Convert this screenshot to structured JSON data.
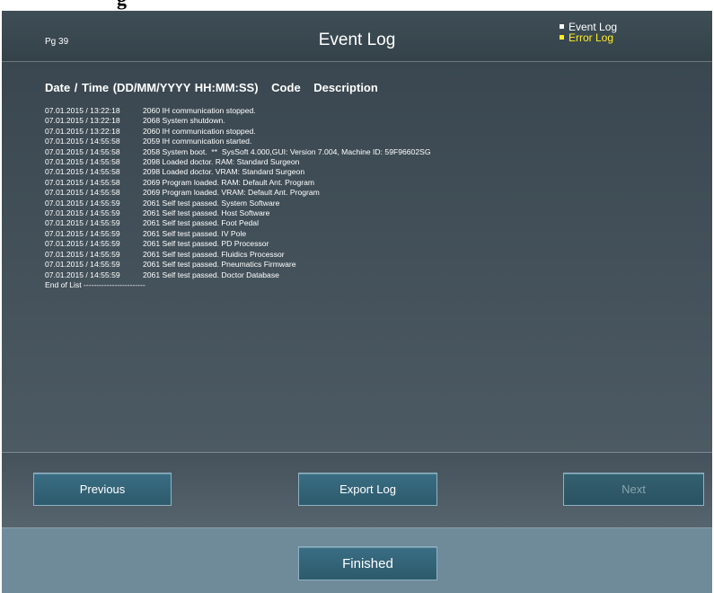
{
  "caption_fragment": "g",
  "header": {
    "page_number": "Pg 39",
    "title": "Event Log",
    "legend": {
      "event_log": "Event Log",
      "error_log": "Error Log"
    }
  },
  "colors": {
    "error_log_accent": "#ffee22",
    "button_fill": "#34667b",
    "footer_fill": "#6f8b99"
  },
  "log": {
    "columns": [
      "Date / Time (DD/MM/YYYY HH:MM:SS)",
      "Code",
      "Description"
    ],
    "rows": [
      {
        "datetime": "07.01.2015 / 13:22:18",
        "entry": "2060 IH communication stopped."
      },
      {
        "datetime": "07.01.2015 / 13:22:18",
        "entry": "2068 System shutdown."
      },
      {
        "datetime": "07.01.2015 / 13:22:18",
        "entry": "2060 IH communication stopped."
      },
      {
        "datetime": "07.01.2015 / 14:55:58",
        "entry": "2059 IH communication started."
      },
      {
        "datetime": "07.01.2015 / 14:55:58",
        "entry": "2058 System boot.  **  SysSoft 4.000,GUI: Version 7.004, Machine ID: 59F96602SG"
      },
      {
        "datetime": "07.01.2015 / 14:55:58",
        "entry": "2098 Loaded doctor. RAM: Standard Surgeon"
      },
      {
        "datetime": "07.01.2015 / 14:55:58",
        "entry": "2098 Loaded doctor. VRAM: Standard Surgeon"
      },
      {
        "datetime": "07.01.2015 / 14:55:58",
        "entry": "2069 Program loaded. RAM: Default Ant. Program"
      },
      {
        "datetime": "07.01.2015 / 14:55:58",
        "entry": "2069 Program loaded. VRAM: Default Ant. Program"
      },
      {
        "datetime": "07.01.2015 / 14:55:59",
        "entry": "2061 Self test passed. System Software"
      },
      {
        "datetime": "07.01.2015 / 14:55:59",
        "entry": "2061 Self test passed. Host Software"
      },
      {
        "datetime": "07.01.2015 / 14:55:59",
        "entry": "2061 Self test passed. Foot Pedal"
      },
      {
        "datetime": "07.01.2015 / 14:55:59",
        "entry": "2061 Self test passed. IV Pole"
      },
      {
        "datetime": "07.01.2015 / 14:55:59",
        "entry": "2061 Self test passed. PD Processor"
      },
      {
        "datetime": "07.01.2015 / 14:55:59",
        "entry": "2061 Self test passed. Fluidics Processor"
      },
      {
        "datetime": "07.01.2015 / 14:55:59",
        "entry": "2061 Self test passed. Pneumatics Firmware"
      },
      {
        "datetime": "07.01.2015 / 14:55:59",
        "entry": "2061 Self test passed. Doctor Database"
      }
    ],
    "end_marker": "End of List ------------------------"
  },
  "nav": {
    "previous": "Previous",
    "export_log": "Export Log",
    "next": "Next"
  },
  "footer": {
    "finished": "Finished"
  }
}
